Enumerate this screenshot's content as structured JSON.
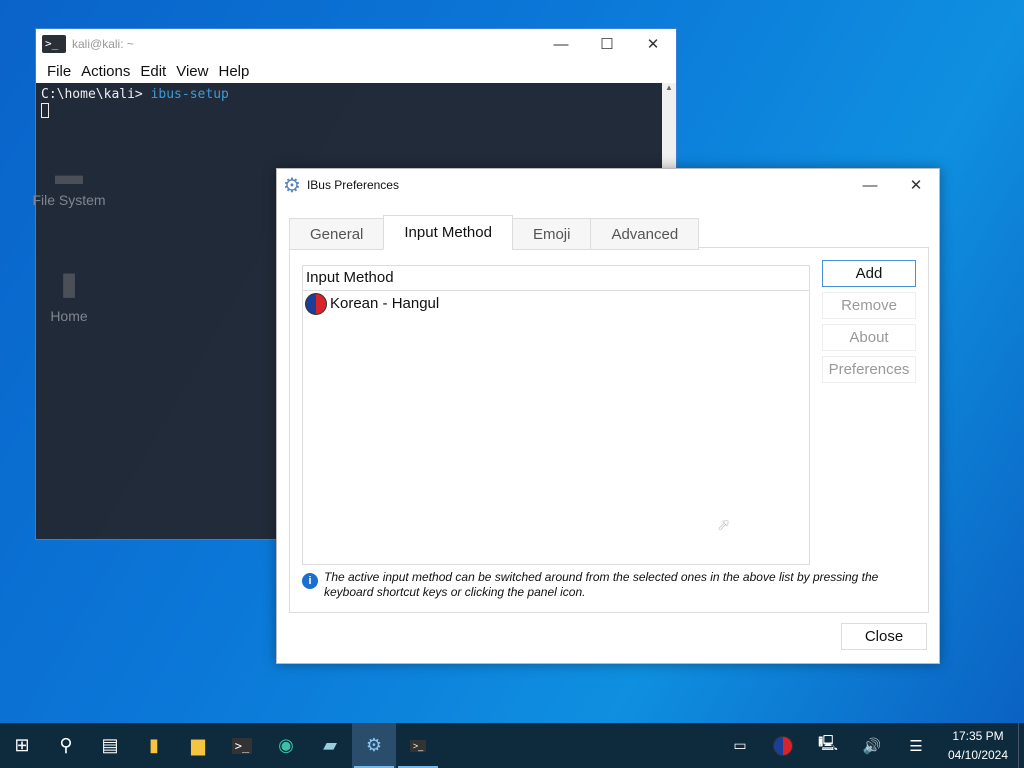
{
  "desktop": {
    "icons": [
      {
        "label": "File System"
      },
      {
        "label": "Home"
      }
    ]
  },
  "terminal": {
    "title": "kali@kali: ~",
    "menu": [
      "File",
      "Actions",
      "Edit",
      "View",
      "Help"
    ],
    "prompt": "C:\\home\\kali>",
    "command": "ibus-setup"
  },
  "dialog": {
    "title": "IBus Preferences",
    "tabs": [
      "General",
      "Input Method",
      "Emoji",
      "Advanced"
    ],
    "active_tab": "Input Method",
    "list_header": "Input Method",
    "items": [
      {
        "label": "Korean - Hangul"
      }
    ],
    "buttons": {
      "add": "Add",
      "remove": "Remove",
      "about": "About",
      "preferences": "Preferences",
      "close": "Close"
    },
    "info": "The active input method can be switched around from the selected ones in the above list by pressing the keyboard shortcut keys or clicking the panel icon."
  },
  "taskbar": {
    "time": "17:35 PM",
    "date": "04/10/2024",
    "apps": [
      "start",
      "search",
      "task-view",
      "file-explorer",
      "files",
      "terminal",
      "edge",
      "notes",
      "ibus-preferences",
      "terminal-running"
    ]
  },
  "colors": {
    "accent": "#4a90d9",
    "taskbar": "#0e2a3d",
    "terminal_bg": "#222834",
    "command": "#3d9ad6"
  }
}
